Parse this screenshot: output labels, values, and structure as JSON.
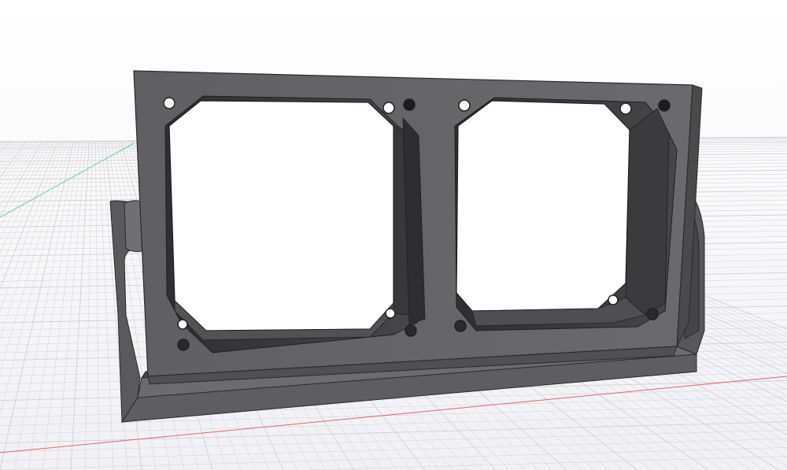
{
  "viewport": {
    "background_top": "#ffffff",
    "background_bottom": "#f3f3f5",
    "grid_color": "#cfcfd6",
    "x_axis_color": "#e05a5a",
    "y_axis_color": "#6fcf8a"
  },
  "model": {
    "kind": "dual 120mm fan mount bracket",
    "front_plate_color": "#636366",
    "face_dark_color": "#3a3a3c",
    "bracket_color": "#5b5b5e",
    "fan_openings": 2,
    "mount_holes_per_fan": 4
  }
}
